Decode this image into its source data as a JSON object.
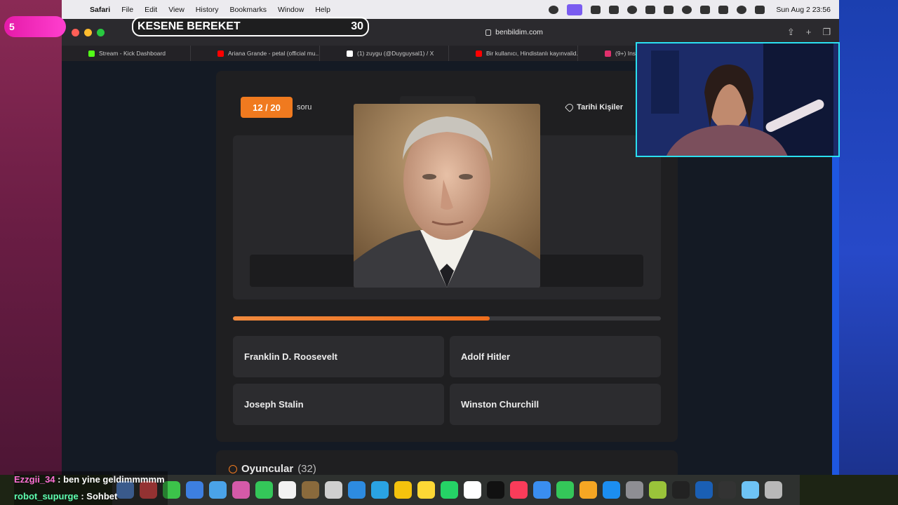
{
  "menubar": {
    "app": "Safari",
    "items": [
      "File",
      "Edit",
      "View",
      "History",
      "Bookmarks",
      "Window",
      "Help"
    ],
    "clock": "Sun Aug 2  23:56"
  },
  "browser": {
    "url": "benbildim.com",
    "tabs": [
      {
        "label": "Stream - Kick Dashboard",
        "favicon_color": "#53fc18"
      },
      {
        "label": "Ariana Grande - petal (official mu...",
        "favicon_color": "#ff0000"
      },
      {
        "label": "(1) zuygu (@Duyguysal1) / X",
        "favicon_color": "#ffffff"
      },
      {
        "label": "Bir kullanıcı, Hindistanlı kayınvalid...",
        "favicon_color": "#ff0000"
      },
      {
        "label": "(9+) Ins",
        "favicon_color": "#e1306c"
      }
    ]
  },
  "quiz": {
    "counter": "12 / 20",
    "counter_suffix": "soru",
    "category": "Tarihi Kişiler",
    "progress_fraction": 0.6,
    "options": [
      "Franklin D. Roosevelt",
      "Adolf Hitler",
      "Joseph Stalin",
      "Winston Churchill"
    ],
    "players_title": "Oyuncular",
    "players_count": "(32)"
  },
  "stream": {
    "pill_number": "5",
    "goal_title": "KESENE BEREKET",
    "goal_count": "30",
    "chat": [
      {
        "user": "Ezzgii_34",
        "message": " : ben yine geldimmmmm"
      },
      {
        "user": "robot_supurge",
        "message": " : Sohbet"
      }
    ]
  },
  "colors": {
    "accent": "#f07a1f",
    "page_bg": "#141a24",
    "card_bg": "#1f1f21",
    "stream_pink": "#e51aa8",
    "webcam_border": "#2be0f0"
  }
}
